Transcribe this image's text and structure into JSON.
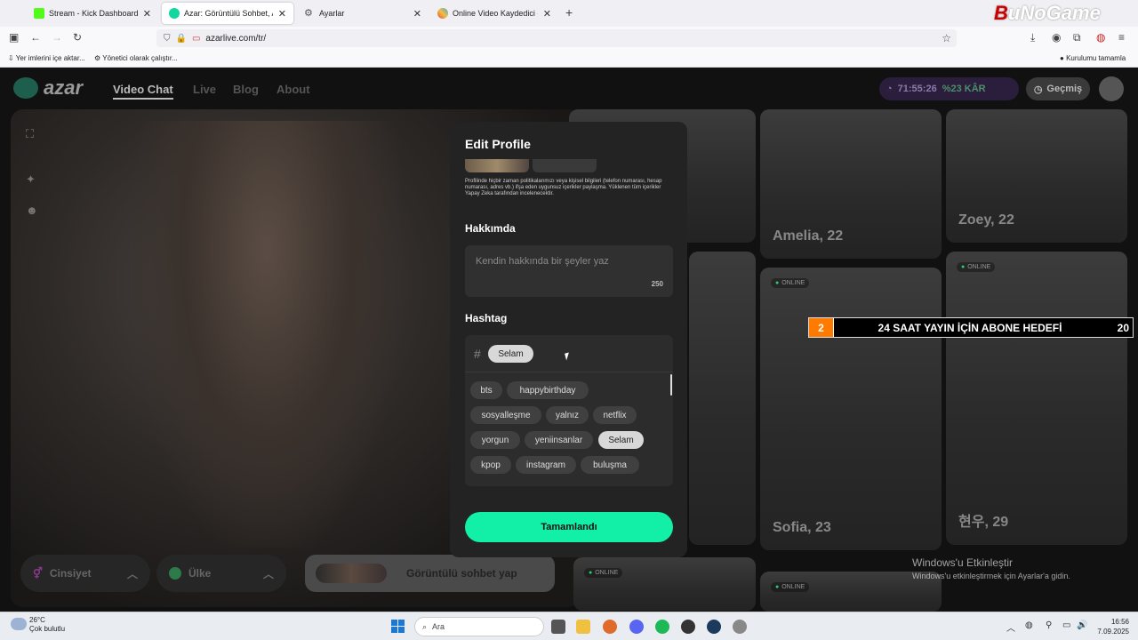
{
  "browser": {
    "tabs": [
      {
        "title": "Stream - Kick Dashboard",
        "color": "#53fc18"
      },
      {
        "title": "Azar: Görüntülü Sohbet, Arkadaş",
        "color": "#12d6a0"
      },
      {
        "title": "Ayarlar",
        "color": "#666666"
      },
      {
        "title": "Online Video Kaydedici - Mikrofo",
        "color": "#e05050"
      }
    ],
    "url": "azarlive.com/tr/",
    "bookmarks": {
      "import": "Yer imlerini içe aktar...",
      "admin": "Yönetici olarak çalıştır...",
      "setup": "Kurulumu tamamla"
    },
    "watermark": {
      "a": "B",
      "b": "uNoGame"
    }
  },
  "site": {
    "logo_word": "azar",
    "nav": {
      "video_chat": "Video Chat",
      "live": "Live",
      "blog": "Blog",
      "about": "About"
    },
    "timer": "71:55:26",
    "timer_kar": "%23 KÂR",
    "history": "Geçmiş",
    "gender": "Cinsiyet",
    "country": "Ülke",
    "start_chat": "Görüntülü sohbet yap",
    "cards": {
      "amelia": "Amelia, 22",
      "zoey": "Zoey, 22",
      "sofia": "Sofia, 23",
      "hyunwoo": "현우, 29",
      "online": "ONLINE"
    }
  },
  "banner": {
    "left": "2",
    "text": "24 SAAT YAYIN İÇİN ABONE HEDEFİ",
    "right": "20"
  },
  "modal": {
    "title": "Edit Profile",
    "policy": "Profilinde hiçbir zaman politikalarımızı veya kişisel bilgileri (telefon numarası, hesap numarası, adres vb.) ifşa eden uygunsuz içerikler paylaşma. Yüklenen tüm içerikler Yapay Zeka tarafından incelenecektir.",
    "about_heading": "Hakkımda",
    "about_placeholder": "Kendin hakkında bir şeyler yaz",
    "about_count": "250",
    "hashtag_heading": "Hashtag",
    "hash_symbol": "#",
    "selected_tag": "Selam",
    "tags": [
      "bts",
      "happybirthday",
      "sosyalleşme",
      "yalnız",
      "netflix",
      "yorgun",
      "yeniinsanlar",
      "Selam",
      "kpop",
      "instagram",
      "buluşma"
    ],
    "done": "Tamamlandı"
  },
  "windows": {
    "activate_title": "Windows'u Etkinleştir",
    "activate_sub": "Windows'u etkinleştirmek için Ayarlar'a gidin."
  },
  "taskbar": {
    "temp": "26°C",
    "weather": "Çok bulutlu",
    "search": "Ara",
    "time": "16:56",
    "date": "7.09.2025"
  }
}
